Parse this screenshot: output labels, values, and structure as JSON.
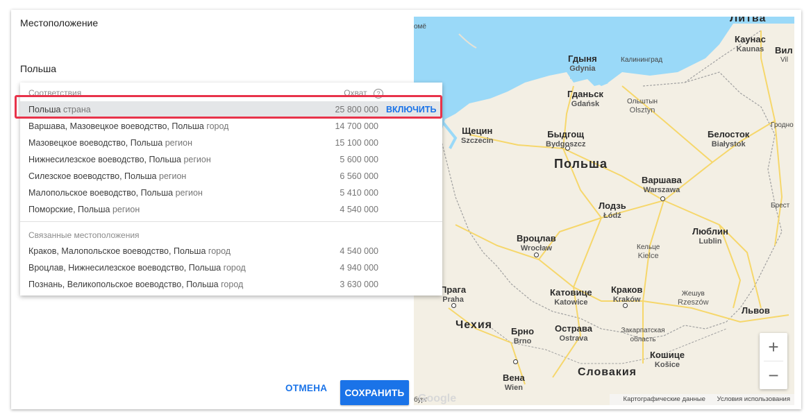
{
  "location_label": "Местоположение",
  "input_value": "Польша",
  "dropdown": {
    "header_matches": "Соответствия",
    "header_reach": "Охват",
    "help_icon": "?",
    "matches": [
      {
        "name": "Польша",
        "type": "страна",
        "reach": "25 800 000",
        "action": "ВКЛЮЧИТЬ"
      },
      {
        "name": "Варшава, Мазовецкое воеводство, Польша",
        "type": "город",
        "reach": "14 700 000"
      },
      {
        "name": "Мазовецкое воеводство, Польша",
        "type": "регион",
        "reach": "15 100 000"
      },
      {
        "name": "Нижнесилезское воеводство, Польша",
        "type": "регион",
        "reach": "5 600 000"
      },
      {
        "name": "Силезское воеводство, Польша",
        "type": "регион",
        "reach": "6 560 000"
      },
      {
        "name": "Малопольское воеводство, Польша",
        "type": "регион",
        "reach": "5 410 000"
      },
      {
        "name": "Поморские, Польша",
        "type": "регион",
        "reach": "4 540 000"
      }
    ],
    "related_header": "Связанные местоположения",
    "related": [
      {
        "name": "Краков, Малопольское воеводство, Польша",
        "type": "город",
        "reach": "4 540 000"
      },
      {
        "name": "Вроцлав, Нижнесилезское воеводство, Польша",
        "type": "город",
        "reach": "4 940 000"
      },
      {
        "name": "Познань, Великопольское воеводство, Польша",
        "type": "город",
        "reach": "3 630 000"
      }
    ]
  },
  "buttons": {
    "cancel": "ОТМЕНА",
    "save": "СОХРАНИТЬ"
  },
  "map": {
    "countries": {
      "poland": "Польша",
      "czechia": "Чехия",
      "slovakia": "Словакия",
      "lithuania": "Литва"
    },
    "cities": {
      "gdynia": {
        "ru": "Гдыня",
        "local": "Gdynia"
      },
      "gdansk": {
        "ru": "Гданьск",
        "local": "Gdańsk"
      },
      "kaliningrad": {
        "ru": "Калининград"
      },
      "kaunas": {
        "ru": "Каунас",
        "local": "Kaunas"
      },
      "olsztyn": {
        "ru": "Ольштын",
        "local": "Olsztyn"
      },
      "szczecin": {
        "ru": "Щецин",
        "local": "Szczecin"
      },
      "bydgoszcz": {
        "ru": "Быдгощ",
        "local": "Bydgoszcz"
      },
      "bialystok": {
        "ru": "Белосток",
        "local": "Białystok"
      },
      "grodno": {
        "ru": "Гродно"
      },
      "warsaw": {
        "ru": "Варшава",
        "local": "Warszawa"
      },
      "lodz": {
        "ru": "Лодзь",
        "local": "Łódź"
      },
      "brest": {
        "ru": "Брест"
      },
      "lublin": {
        "ru": "Люблин",
        "local": "Lublin"
      },
      "wroclaw": {
        "ru": "Вроцлав",
        "local": "Wrocław"
      },
      "kielce": {
        "ru": "Кельце",
        "local": "Kielce"
      },
      "prague": {
        "ru": "Прага",
        "local": "Praha"
      },
      "katowice": {
        "ru": "Катовице",
        "local": "Katowice"
      },
      "krakow": {
        "ru": "Краков",
        "local": "Kraków"
      },
      "rzeszow": {
        "ru": "Жешув",
        "local": "Rzeszów"
      },
      "lviv": {
        "ru": "Львов"
      },
      "ostrava": {
        "ru": "Острава",
        "local": "Ostrava"
      },
      "zakarpattia": {
        "ru": "Закарпатская область"
      },
      "brno": {
        "ru": "Брно",
        "local": "Brno"
      },
      "kosice": {
        "ru": "Кошице",
        "local": "Košice"
      },
      "vienna": {
        "ru": "Вена",
        "local": "Wien"
      },
      "partial_top_left": {
        "ru": "омё"
      },
      "partial_vil": {
        "ru": "Вил"
      },
      "partial_vil2": {
        "ru": "Vil"
      },
      "partial_bottom_left": {
        "ru": "бург"
      }
    },
    "attribution": {
      "data": "Картографические данные",
      "terms": "Условия использования"
    },
    "google_logo": "Google",
    "zoom_in": "+",
    "zoom_out": "−",
    "colors": {
      "water": "#9ad9f8",
      "land": "#f3efe4",
      "road": "#f6d76b",
      "border": "#a0a0a0"
    }
  }
}
